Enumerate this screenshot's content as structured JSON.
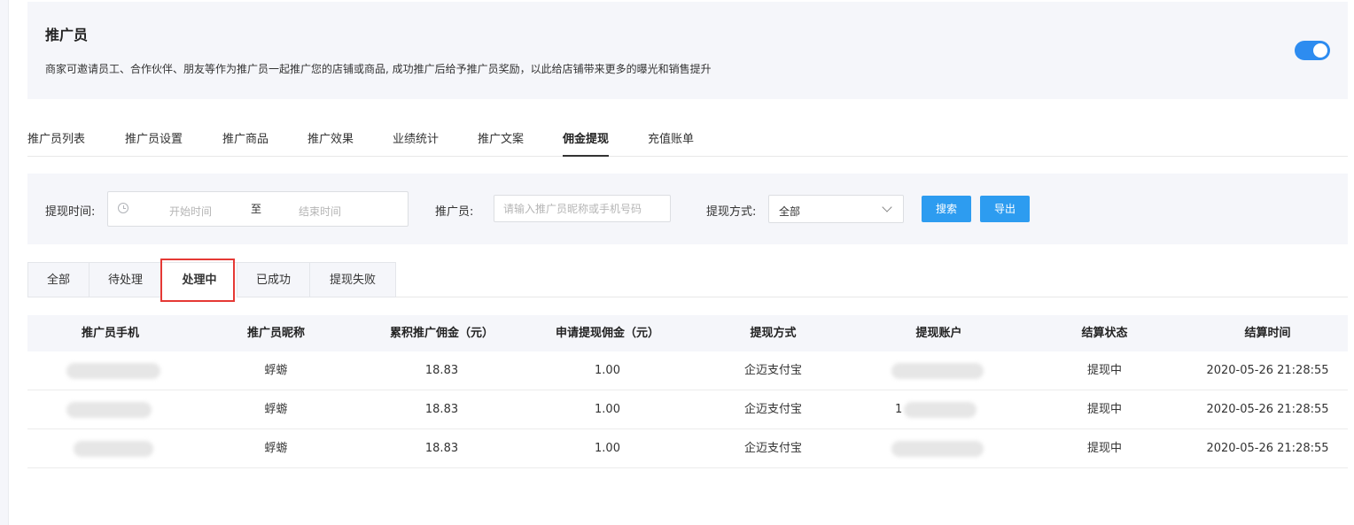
{
  "promo": {
    "title": "推广员",
    "description": "商家可邀请员工、合作伙伴、朋友等作为推广员一起推广您的店铺或商品, 成功推广后给予推广员奖励，以此给店铺带来更多的曝光和销售提升",
    "enabled": true
  },
  "main_tabs": [
    {
      "label": "推广员列表",
      "active": false
    },
    {
      "label": "推广员设置",
      "active": false
    },
    {
      "label": "推广商品",
      "active": false
    },
    {
      "label": "推广效果",
      "active": false
    },
    {
      "label": "业绩统计",
      "active": false
    },
    {
      "label": "推广文案",
      "active": false
    },
    {
      "label": "佣金提现",
      "active": true
    },
    {
      "label": "充值账单",
      "active": false
    }
  ],
  "filters": {
    "time_label": "提现时间:",
    "start_placeholder": "开始时间",
    "separator": "至",
    "end_placeholder": "结束时间",
    "promoter_label": "推广员:",
    "promoter_placeholder": "请输入推广员昵称或手机号码",
    "method_label": "提现方式:",
    "method_value": "全部",
    "search_label": "搜索",
    "export_label": "导出"
  },
  "status_tabs": [
    {
      "label": "全部",
      "active": false
    },
    {
      "label": "待处理",
      "active": false
    },
    {
      "label": "处理中",
      "active": true
    },
    {
      "label": "已成功",
      "active": false
    },
    {
      "label": "提现失败",
      "active": false
    }
  ],
  "table": {
    "headers": [
      "推广员手机",
      "推广员昵称",
      "累积推广佣金（元）",
      "申请提现佣金（元）",
      "提现方式",
      "提现账户",
      "结算状态",
      "结算时间"
    ],
    "rows": [
      {
        "phone": "",
        "nickname": "蜉蝣",
        "total_commission": "18.83",
        "requested": "1.00",
        "method": "企迈支付宝",
        "account": "",
        "status": "提现中",
        "time": "2020-05-26 21:28:55"
      },
      {
        "phone": "",
        "nickname": "蜉蝣",
        "total_commission": "18.83",
        "requested": "1.00",
        "method": "企迈支付宝",
        "account": "1",
        "status": "提现中",
        "time": "2020-05-26 21:28:55"
      },
      {
        "phone": "",
        "nickname": "蜉蝣",
        "total_commission": "18.83",
        "requested": "1.00",
        "method": "企迈支付宝",
        "account": "",
        "status": "提现中",
        "time": "2020-05-26 21:28:55"
      }
    ]
  }
}
